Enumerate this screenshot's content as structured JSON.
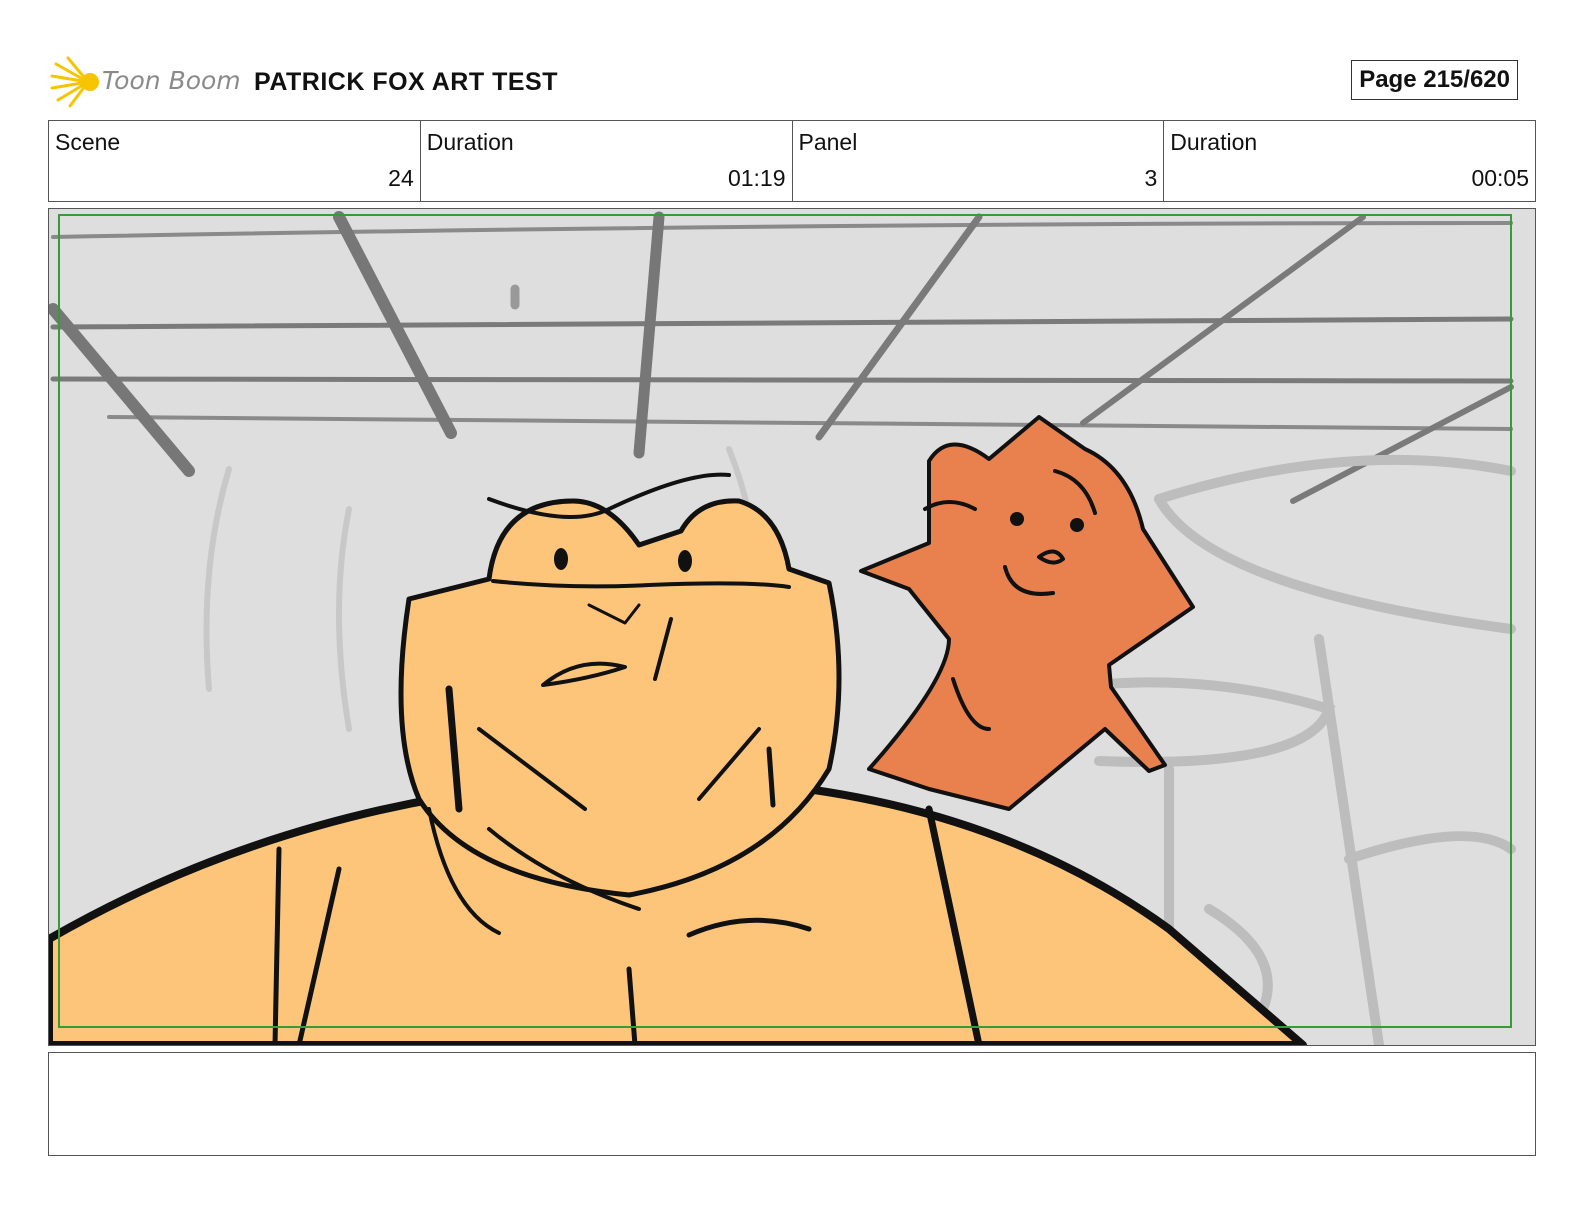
{
  "header": {
    "logo_text": "Toon Boom",
    "project_title": "PATRICK FOX ART TEST",
    "page_label": "Page 215/620"
  },
  "info": {
    "scene_label": "Scene",
    "scene_value": "24",
    "scene_duration_label": "Duration",
    "scene_duration_value": "01:19",
    "panel_label": "Panel",
    "panel_value": "3",
    "panel_duration_label": "Duration",
    "panel_duration_value": "00:05"
  },
  "colors": {
    "background_sketch": "#dedede",
    "character_skin": "#fdc57a",
    "fox_orange": "#e8814d",
    "safe_frame_green": "#3a9a3a",
    "logo_yellow": "#f6c400"
  },
  "notes": {
    "text": ""
  }
}
